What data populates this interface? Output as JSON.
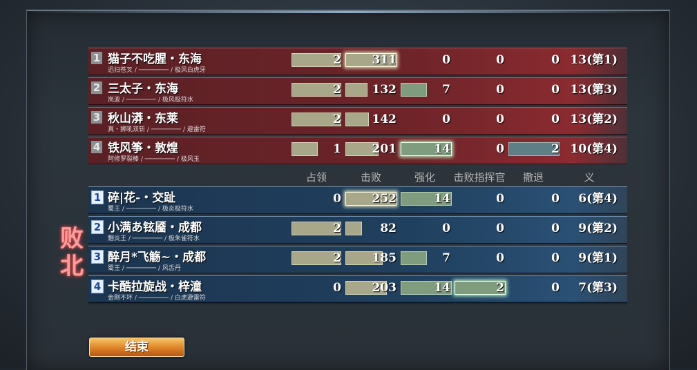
{
  "headers": [
    "占领",
    "击败",
    "强化",
    "击败指挥官",
    "撤退",
    "义"
  ],
  "result_label": "败北",
  "end_button": "结束",
  "red_team": [
    {
      "rank": "1",
      "name": "猫子不吃腥・东海",
      "sub": "迅扫苍叉 / ──────── / 极风白虎牙",
      "occupy": "2",
      "kills": "311",
      "enhance": "0",
      "commander": "0",
      "retreat": "0",
      "honor": "13(第1)"
    },
    {
      "rank": "2",
      "name": "三太子・东海",
      "sub": "岚波 / ──────── / 极风极符水",
      "occupy": "2",
      "kills": "132",
      "enhance": "7",
      "commander": "0",
      "retreat": "0",
      "honor": "13(第3)"
    },
    {
      "rank": "3",
      "name": "秋山漭・东莱",
      "sub": "真・狮吼双斩 / ──────── / 避雷符",
      "occupy": "2",
      "kills": "142",
      "enhance": "0",
      "commander": "0",
      "retreat": "0",
      "honor": "13(第2)"
    },
    {
      "rank": "4",
      "name": "铁风筝・敦煌",
      "sub": "阿修罗裂棒 / ──────── / 极风玉",
      "occupy": "1",
      "kills": "201",
      "enhance": "14",
      "commander": "0",
      "retreat": "2",
      "honor": "10(第4)"
    }
  ],
  "blue_team": [
    {
      "rank": "1",
      "name": "碎|花-・交趾",
      "sub": "蜀王 / ──────── / 极炎极符水",
      "occupy": "0",
      "kills": "252",
      "enhance": "14",
      "commander": "0",
      "retreat": "0",
      "honor": "6(第4)"
    },
    {
      "rank": "2",
      "name": "小满あ铉靥・成都",
      "sub": "魍炎王 / ──────── / 极朱雀符水",
      "occupy": "2",
      "kills": "82",
      "enhance": "0",
      "commander": "0",
      "retreat": "0",
      "honor": "9(第2)"
    },
    {
      "rank": "3",
      "name": "醉月*飞觞~・成都",
      "sub": "蜀王 / ──────── / 风舌丹",
      "occupy": "2",
      "kills": "185",
      "enhance": "7",
      "commander": "0",
      "retreat": "0",
      "honor": "9(第1)"
    },
    {
      "rank": "4",
      "name": "卡酷拉旋战・梓潼",
      "sub": "金刚不坏 / ──────── / 白虎避雷符",
      "occupy": "0",
      "kills": "203",
      "enhance": "14",
      "commander": "2",
      "retreat": "0",
      "honor": "7(第3)"
    }
  ],
  "colors": {
    "red_row": "#6e2429",
    "blue_row": "#20405f",
    "bar_tan": "#a9a78a",
    "bar_green": "#7f9d7e",
    "bar_teal": "#5f7f86",
    "defeat": "#f4a0a0",
    "button": "#e0872a"
  }
}
